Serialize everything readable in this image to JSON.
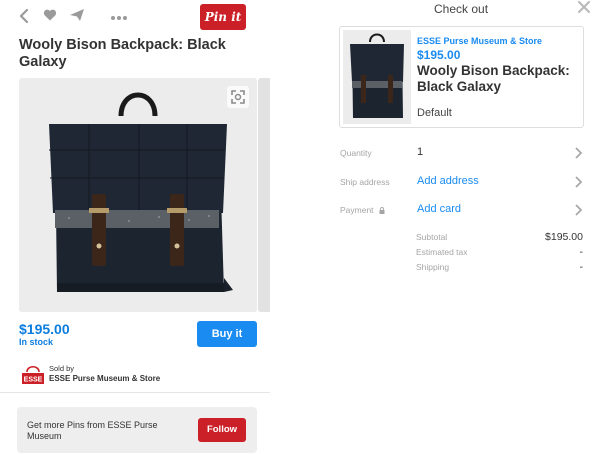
{
  "left": {
    "topbar": {
      "back_icon": "chevron-left-icon",
      "heart_icon": "heart-icon",
      "send_icon": "send-icon",
      "more_icon": "more-dots-icon",
      "pin_it_label": "Pin it"
    },
    "title": "Wooly Bison Backpack: Black Galaxy",
    "price": "$195.00",
    "stock": "In stock",
    "buy_label": "Buy it",
    "seller": {
      "sold_by": "Sold by",
      "name": "ESSE Purse Museum & Store",
      "logo_text": "ESSE"
    },
    "more_pins": {
      "text": "Get more Pins from ESSE Purse Museum",
      "follow_label": "Follow"
    }
  },
  "checkout": {
    "title": "Check out",
    "close_icon": "close-icon",
    "product": {
      "store": "ESSE Purse Museum & Store",
      "price": "$195.00",
      "name": "Wooly Bison Backpack: Black Galaxy",
      "variant": "Default"
    },
    "rows": [
      {
        "label": "Quantity",
        "value": "1",
        "is_link": false
      },
      {
        "label": "Ship address",
        "value": "Add address",
        "is_link": true
      },
      {
        "label": "Payment",
        "value": "Add card",
        "is_link": true,
        "icon": "lock-icon"
      }
    ],
    "totals": [
      {
        "label": "Subtotal",
        "value": "$195.00"
      },
      {
        "label": "Estimated tax",
        "value": "-"
      },
      {
        "label": "Shipping",
        "value": "-"
      }
    ]
  },
  "colors": {
    "pinterest_red": "#cb2027",
    "link_blue": "#1a8bf0",
    "price_blue": "#0a7ddf"
  }
}
